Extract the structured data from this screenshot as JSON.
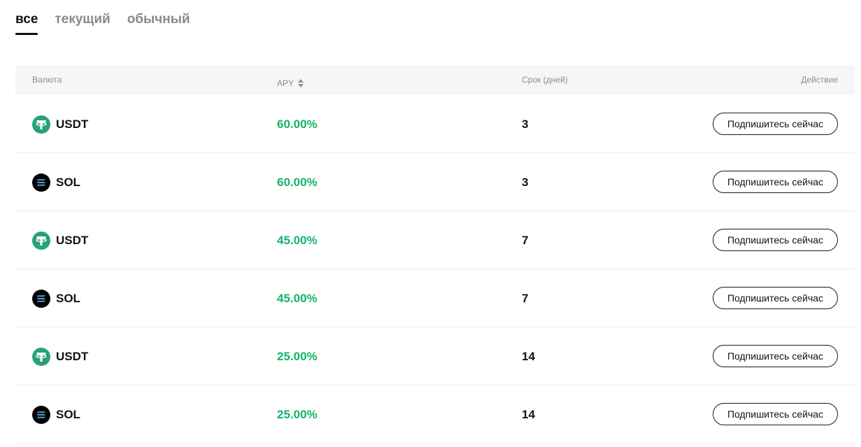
{
  "tabs": [
    {
      "label": "все",
      "active": true
    },
    {
      "label": "текущий",
      "active": false
    },
    {
      "label": "обычный",
      "active": false
    }
  ],
  "table": {
    "columns": {
      "currency": "Валюта",
      "apy": "APY",
      "term": "Срок (дней)",
      "action": "Действие"
    },
    "rows": [
      {
        "coin": "USDT",
        "icon": "usdt-icon",
        "apy": "60.00%",
        "term": "3",
        "action_label": "Подпишитесь сейчас"
      },
      {
        "coin": "SOL",
        "icon": "sol-icon",
        "apy": "60.00%",
        "term": "3",
        "action_label": "Подпишитесь сейчас"
      },
      {
        "coin": "USDT",
        "icon": "usdt-icon",
        "apy": "45.00%",
        "term": "7",
        "action_label": "Подпишитесь сейчас"
      },
      {
        "coin": "SOL",
        "icon": "sol-icon",
        "apy": "45.00%",
        "term": "7",
        "action_label": "Подпишитесь сейчас"
      },
      {
        "coin": "USDT",
        "icon": "usdt-icon",
        "apy": "25.00%",
        "term": "14",
        "action_label": "Подпишитесь сейчас"
      },
      {
        "coin": "SOL",
        "icon": "sol-icon",
        "apy": "25.00%",
        "term": "14",
        "action_label": "Подпишитесь сейчас"
      }
    ]
  },
  "colors": {
    "apy": "#11b469",
    "usdt": "#26a17b",
    "sol_bg": "#000000"
  }
}
